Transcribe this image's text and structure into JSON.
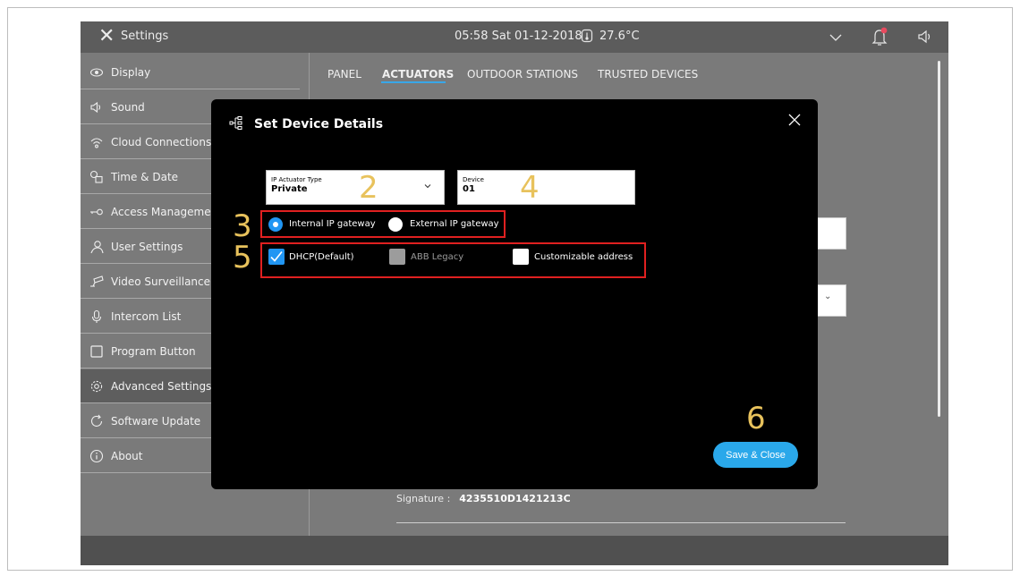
{
  "topbar": {
    "close_glyph": "✕",
    "title": "Settings",
    "datetime": "05:58  Sat 01-12-2018",
    "temperature": "27.6°C",
    "icons": [
      "clock-icon",
      "chevron-down-icon",
      "bell-icon",
      "speaker-icon"
    ],
    "accent_notification": "#e84a5f"
  },
  "sidebar": {
    "items": [
      {
        "label": "Display",
        "icon": "eye-icon"
      },
      {
        "label": "Sound",
        "icon": "speaker-icon"
      },
      {
        "label": "Cloud Connections",
        "icon": "wifi-icon"
      },
      {
        "label": "Time & Date",
        "icon": "clock-icon"
      },
      {
        "label": "Access Manageme",
        "icon": "key-icon"
      },
      {
        "label": "User Settings",
        "icon": "user-icon"
      },
      {
        "label": "Video Surveillance",
        "icon": "camera-icon"
      },
      {
        "label": "Intercom List",
        "icon": "mic-icon"
      },
      {
        "label": "Program Button",
        "icon": "square-icon"
      },
      {
        "label": "Advanced Settings",
        "icon": "gear-icon",
        "active": true
      },
      {
        "label": "Software Update",
        "icon": "refresh-icon"
      },
      {
        "label": "About",
        "icon": "info-icon"
      }
    ]
  },
  "tabs": [
    {
      "label": "PANEL"
    },
    {
      "label": "ACTUATORS",
      "active": true
    },
    {
      "label": "OUTDOOR STATIONS"
    },
    {
      "label": "TRUSTED DEVICES"
    }
  ],
  "background": {
    "signature_label": "Signature :",
    "signature_value": "4235510D1421213C",
    "chevron": "⌄"
  },
  "modal": {
    "title": "Set Device Details",
    "actuator_type": {
      "label": "IP Actuator Type",
      "value": "Private"
    },
    "device": {
      "label": "Device",
      "value": "01"
    },
    "gateway_options": [
      {
        "label": "Internal IP gateway",
        "selected": true
      },
      {
        "label": "External IP gateway",
        "selected": false
      }
    ],
    "address_options": [
      {
        "label": "DHCP(Default)",
        "state": "checked"
      },
      {
        "label": "ABB Legacy",
        "state": "disabled"
      },
      {
        "label": "Customizable address",
        "state": "unchecked"
      }
    ],
    "save_button": "Save & Close",
    "accent": "#2aa8ea"
  },
  "annotations": {
    "n2": "2",
    "n3": "3",
    "n4": "4",
    "n5": "5",
    "n6": "6",
    "number_color": "#e8c25c",
    "box_color": "#e02020"
  }
}
